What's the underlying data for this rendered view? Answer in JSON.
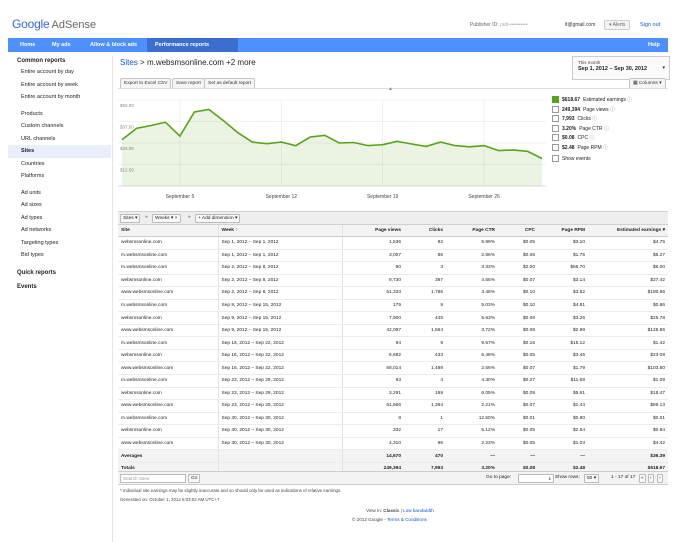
{
  "header": {
    "logo_google": "Google",
    "logo_product": "AdSense",
    "publisher_label": "Publisher ID:",
    "publisher_id": "pub-••••••••••",
    "account_email": "lt@gmail.com",
    "alerts_label": "Alerts",
    "signout_label": "Sign out"
  },
  "nav": {
    "tabs": [
      {
        "label": "Home"
      },
      {
        "label": "My ads"
      },
      {
        "label": "Allow & block ads"
      },
      {
        "label": "Performance reports"
      }
    ],
    "help_label": "Help"
  },
  "sidebar": {
    "common_reports": "Common reports",
    "items": [
      {
        "label": "Entire account by day"
      },
      {
        "label": "Entire account by week"
      },
      {
        "label": "Entire account by month"
      },
      {
        "label": "Products"
      },
      {
        "label": "Custom channels"
      },
      {
        "label": "URL channels"
      },
      {
        "label": "Sites"
      },
      {
        "label": "Countries"
      },
      {
        "label": "Platforms"
      },
      {
        "label": "Ad units"
      },
      {
        "label": "Ad sizes"
      },
      {
        "label": "Ad types"
      },
      {
        "label": "Ad networks"
      },
      {
        "label": "Targeting types"
      },
      {
        "label": "Bid types"
      }
    ],
    "quick_reports": "Quick reports",
    "events": "Events"
  },
  "breadcrumb": {
    "root": "Sites",
    "sep": ">",
    "current": "m.websmsonline.com +2 more"
  },
  "daterange": {
    "label": "This month",
    "value": "Sep 1, 2012 – Sep 30, 2012"
  },
  "toolbar": {
    "export_label": "Export to Excel CSV",
    "save_label": "Save report",
    "default_label": "Set as default report",
    "columns_label": "Columns"
  },
  "chart_data": {
    "type": "area",
    "series": [
      {
        "name": "Estimated earnings"
      }
    ],
    "x": [
      "Sep 1",
      "Sep 2",
      "Sep 3",
      "Sep 4",
      "Sep 5",
      "Sep 6",
      "Sep 7",
      "Sep 8",
      "Sep 9",
      "Sep 10",
      "Sep 11",
      "Sep 12",
      "Sep 13",
      "Sep 14",
      "Sep 15",
      "Sep 16",
      "Sep 17",
      "Sep 18",
      "Sep 19",
      "Sep 20",
      "Sep 21",
      "Sep 22",
      "Sep 23",
      "Sep 24",
      "Sep 25",
      "Sep 26",
      "Sep 27",
      "Sep 28",
      "Sep 29",
      "Sep 30"
    ],
    "values": [
      26.9,
      33.5,
      35.2,
      37.1,
      29.0,
      43.0,
      44.5,
      38.0,
      31.0,
      25.5,
      24.6,
      25.5,
      23.5,
      28.5,
      29.5,
      25.0,
      25.3,
      23.5,
      24.0,
      26.0,
      24.4,
      23.0,
      25.5,
      23.5,
      22.8,
      23.5,
      20.6,
      21.0,
      20.2,
      16.0
    ],
    "y_ticks": [
      "$0.00",
      "$12.50",
      "$25.00",
      "$37.50",
      "$50.00"
    ],
    "ylim": [
      0,
      50
    ],
    "x_ticks": [
      "September 5",
      "September 12",
      "September 19",
      "September 26"
    ],
    "color": "#58a31b",
    "grid": true
  },
  "legend": [
    {
      "value": "$618.67",
      "label": "Estimated earnings",
      "checked": true
    },
    {
      "value": "249,394",
      "label": "Page views",
      "checked": false
    },
    {
      "value": "7,993",
      "label": "Clicks",
      "checked": false
    },
    {
      "value": "3.20%",
      "label": "Page CTR",
      "checked": false
    },
    {
      "value": "$0.08",
      "label": "CPC",
      "checked": false
    },
    {
      "value": "$2.48",
      "label": "Page RPM",
      "checked": false
    }
  ],
  "show_events_label": "Show events",
  "table_tools": {
    "sites": "Sites",
    "weeks": "Weeks",
    "add_dimension": "Add dimension"
  },
  "table": {
    "headers": [
      "Site",
      "Week",
      "Page views",
      "Clicks",
      "Page CTR",
      "CPC",
      "Page RPM",
      "Estimated earnings"
    ],
    "rows": [
      [
        "websmsonline.com",
        "Sep 1, 2012 – Sep 1, 2012",
        "1,536",
        "92",
        "5.99%",
        "$0.05",
        "$3.10",
        "$4.75"
      ],
      [
        "m.websmsonline.com",
        "Sep 1, 2012 – Sep 1, 2012",
        "3,007",
        "86",
        "2.86%",
        "$0.06",
        "$1.75",
        "$5.27"
      ],
      [
        "m.websmsonline.com",
        "Sep 2, 2012 – Sep 8, 2012",
        "90",
        "3",
        "3.33%",
        "$2.00",
        "$66.70",
        "$6.00"
      ],
      [
        "websmsonline.com",
        "Sep 2, 2012 – Sep 8, 2012",
        "8,730",
        "397",
        "4.55%",
        "$0.07",
        "$3.14",
        "$27.42"
      ],
      [
        "www.websmsonline.com",
        "Sep 2, 2012 – Sep 8, 2012",
        "51,333",
        "1,786",
        "3.48%",
        "$0.10",
        "$3.52",
        "$180.66"
      ],
      [
        "m.websmsonline.com",
        "Sep 9, 2012 – Sep 15, 2012",
        "179",
        "9",
        "5.03%",
        "$0.10",
        "$4.81",
        "$0.86"
      ],
      [
        "websmsonline.com",
        "Sep 9, 2012 – Sep 15, 2012",
        "7,900",
        "445",
        "5.63%",
        "$0.06",
        "$3.26",
        "$25.78"
      ],
      [
        "www.websmsonline.com",
        "Sep 9, 2012 – Sep 15, 2012",
        "42,097",
        "1,564",
        "3.72%",
        "$0.08",
        "$2.99",
        "$125.86"
      ],
      [
        "m.websmsonline.com",
        "Sep 16, 2012 – Sep 22, 2012",
        "94",
        "9",
        "9.57%",
        "$0.16",
        "$15.12",
        "$1.42"
      ],
      [
        "websmsonline.com",
        "Sep 16, 2012 – Sep 22, 2012",
        "6,682",
        "433",
        "6.48%",
        "$0.05",
        "$3.46",
        "$23.09"
      ],
      [
        "www.websmsonline.com",
        "Sep 16, 2012 – Sep 22, 2012",
        "58,014",
        "1,488",
        "2.56%",
        "$0.07",
        "$1.79",
        "$103.60"
      ],
      [
        "m.websmsonline.com",
        "Sep 23, 2012 – Sep 29, 2012",
        "93",
        "4",
        "4.30%",
        "$0.27",
        "$11.69",
        "$1.09"
      ],
      [
        "websmsonline.com",
        "Sep 23, 2012 – Sep 29, 2012",
        "3,291",
        "199",
        "6.05%",
        "$0.09",
        "$5.61",
        "$18.47"
      ],
      [
        "www.websmsonline.com",
        "Sep 23, 2012 – Sep 29, 2012",
        "61,666",
        "1,364",
        "2.21%",
        "$0.07",
        "$1.44",
        "$89.13"
      ],
      [
        "m.websmsonline.com",
        "Sep 30, 2012 – Sep 30, 2012",
        "8",
        "1",
        "12.50%",
        "$0.01",
        "$0.80",
        "$0.01"
      ],
      [
        "websmsonline.com",
        "Sep 30, 2012 – Sep 30, 2012",
        "332",
        "17",
        "5.12%",
        "$0.05",
        "$2.54",
        "$0.84"
      ],
      [
        "www.websmsonline.com",
        "Sep 30, 2012 – Sep 30, 2012",
        "4,310",
        "96",
        "2.23%",
        "$0.05",
        "$1.03",
        "$4.42"
      ]
    ],
    "averages": [
      "Averages",
      "",
      "14,670",
      "470",
      "—",
      "—",
      "—",
      "$36.39"
    ],
    "totals": [
      "Totals",
      "",
      "249,394",
      "7,993",
      "3.20%",
      "$0.08",
      "$2.48",
      "$618.67"
    ]
  },
  "pager": {
    "search_placeholder": "Search Sites",
    "go_label": "Go",
    "goto_label": "Go to page:",
    "page_value": "1",
    "show_rows_label": "Show rows:",
    "rows_value": "50",
    "range_text": "1 - 17 of 17"
  },
  "footer": {
    "footnote": "* Individual site earnings may be slightly inaccurate and so should only be used as indications of relative earnings.",
    "generated": "Generated on: October 1, 2012 6:03:02 AM UTC+7",
    "view_in": "View in:",
    "classic": "Classic",
    "low_bandwidth": "Low bandwidth",
    "copyright": "© 2012 Google -",
    "terms": "Terms & Conditions"
  }
}
